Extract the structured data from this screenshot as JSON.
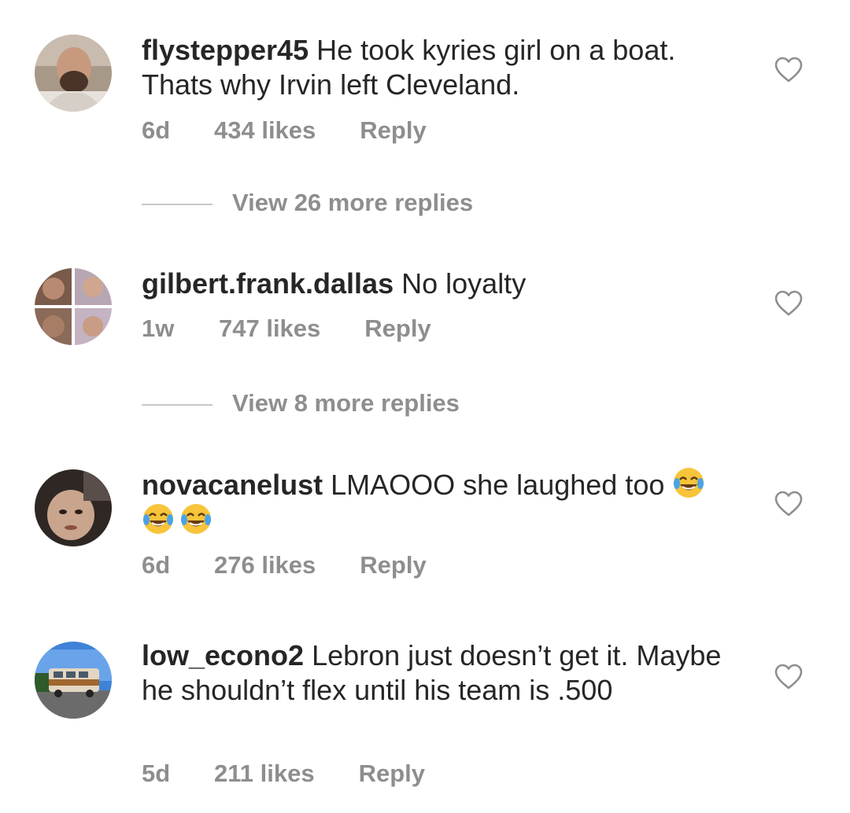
{
  "comments": [
    {
      "username": "flystepper45",
      "text": "He took kyries girl on a boat. Thats why Irvin left Cleveland.",
      "age": "6d",
      "likes": "434 likes",
      "reply": "Reply",
      "view_replies": "View 26 more replies",
      "avatar_icon": "person-photo"
    },
    {
      "username": "gilbert.frank.dallas",
      "text": "No loyalty",
      "age": "1w",
      "likes": "747 likes",
      "reply": "Reply",
      "view_replies": "View 8 more replies",
      "avatar_icon": "collage-photo"
    },
    {
      "username": "novacanelust",
      "text": "LMAOOO she laughed too",
      "emoji": "face-with-tears-of-joy",
      "age": "6d",
      "likes": "276 likes",
      "reply": "Reply",
      "avatar_icon": "person-photo"
    },
    {
      "username": "low_econo2",
      "text": "Lebron just doesn’t get it. Maybe he shouldn’t flex until his team is .500",
      "age": "5d",
      "likes": "211 likes",
      "reply": "Reply",
      "avatar_icon": "van-photo"
    }
  ],
  "colors": {
    "text": "#262626",
    "secondary": "#8e8e8e",
    "divider": "#c7c7c7"
  }
}
